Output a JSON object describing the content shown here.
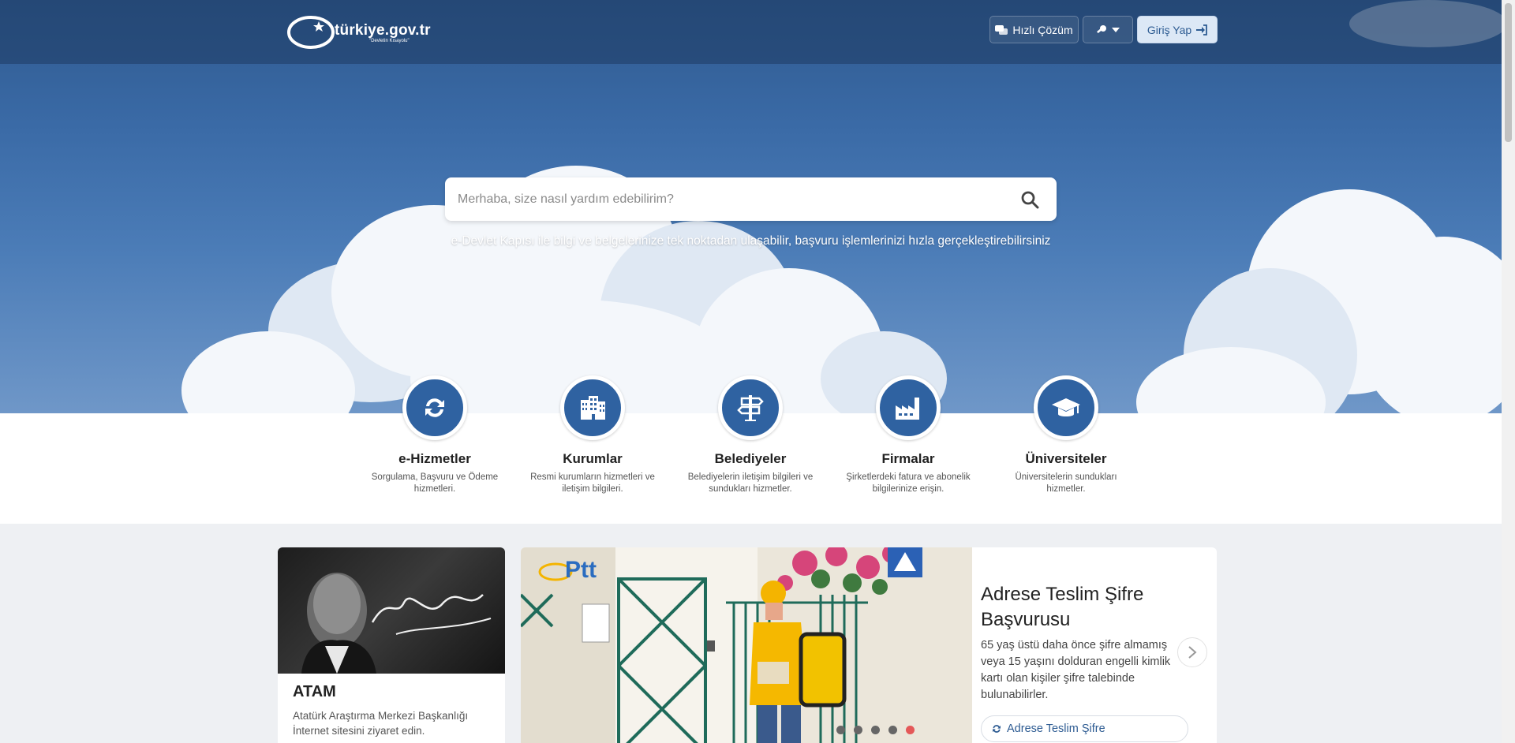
{
  "header": {
    "logo_text": "türkiye.gov.tr",
    "logo_subtext": "\"Devletin Kısayolu\"",
    "quick_solution_label": "Hızlı Çözüm",
    "login_label": "Giriş Yap"
  },
  "search": {
    "placeholder": "Merhaba, size nasıl yardım edebilirim?",
    "tagline": "e-Devlet Kapısı ile bilgi ve belgelerinize tek noktadan ulaşabilir, başvuru işlemlerinizi hızla gerçekleştirebilirsiniz"
  },
  "categories": [
    {
      "title": "e-Hizmetler",
      "desc": "Sorgulama, Başvuru ve Ödeme hizmetleri.",
      "icon": "refresh-icon"
    },
    {
      "title": "Kurumlar",
      "desc": "Resmi kurumların hizmetleri ve iletişim bilgileri.",
      "icon": "building-icon"
    },
    {
      "title": "Belediyeler",
      "desc": "Belediyelerin iletişim bilgileri ve sundukları hizmetler.",
      "icon": "signpost-icon"
    },
    {
      "title": "Firmalar",
      "desc": "Şirketlerdeki fatura ve abonelik bilgilerinize erişin.",
      "icon": "factory-icon"
    },
    {
      "title": "Üniversiteler",
      "desc": "Üniversitelerin sundukları hizmetler.",
      "icon": "graduation-cap-icon"
    }
  ],
  "atam_card": {
    "title": "ATAM",
    "desc": "Atatürk Araştırma Merkezi Başkanlığı İnternet sitesini ziyaret edin.",
    "signature": "K. Atatürk"
  },
  "slider": {
    "ptt_logo": "Ptt",
    "title": "Adrese Teslim Şifre Başvurusu",
    "desc": "65 yaş üstü daha önce şifre almamış veya 15 yaşını dolduran engelli kimlik kartı olan kişiler şifre talebinde bulunabilirler.",
    "button_label": "Adrese Teslim Şifre",
    "dot_count": 5,
    "active_dot": 4
  },
  "colors": {
    "primary": "#2f62a1",
    "hero_top": "#2f5a8f",
    "active_dot": "#e45858"
  }
}
